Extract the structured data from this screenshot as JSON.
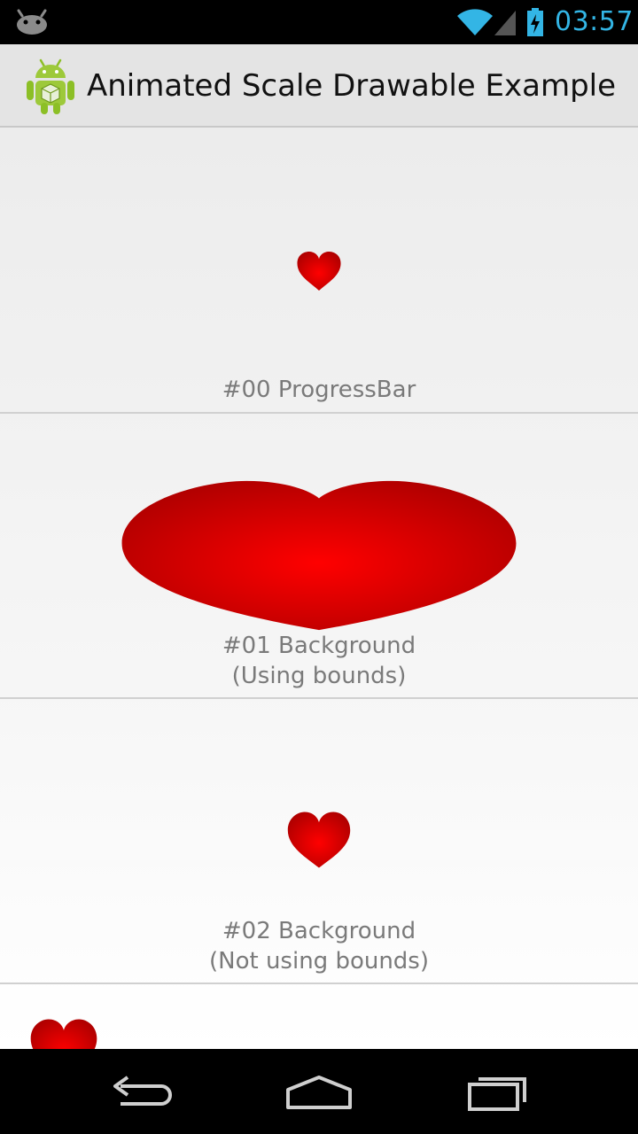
{
  "status_bar": {
    "time": "03:57",
    "icons": [
      "android-notification-icon",
      "wifi-icon",
      "signal-icon",
      "battery-charging-icon"
    ]
  },
  "action_bar": {
    "title": "Animated Scale Drawable Example",
    "icon": "android-app-icon"
  },
  "rows": [
    {
      "caption_line1": "#00 ProgressBar",
      "caption_line2": ""
    },
    {
      "caption_line1": "#01 Background",
      "caption_line2": "(Using bounds)"
    },
    {
      "caption_line1": "#02 Background",
      "caption_line2": "(Not using bounds)"
    },
    {
      "caption_line1": "",
      "caption_line2": ""
    }
  ],
  "nav_bar": {
    "buttons": [
      "back-icon",
      "home-icon",
      "recent-apps-icon"
    ]
  },
  "colors": {
    "accent": "#33b5e5",
    "heart_center": "#ff0000",
    "heart_edge": "#b00000"
  }
}
